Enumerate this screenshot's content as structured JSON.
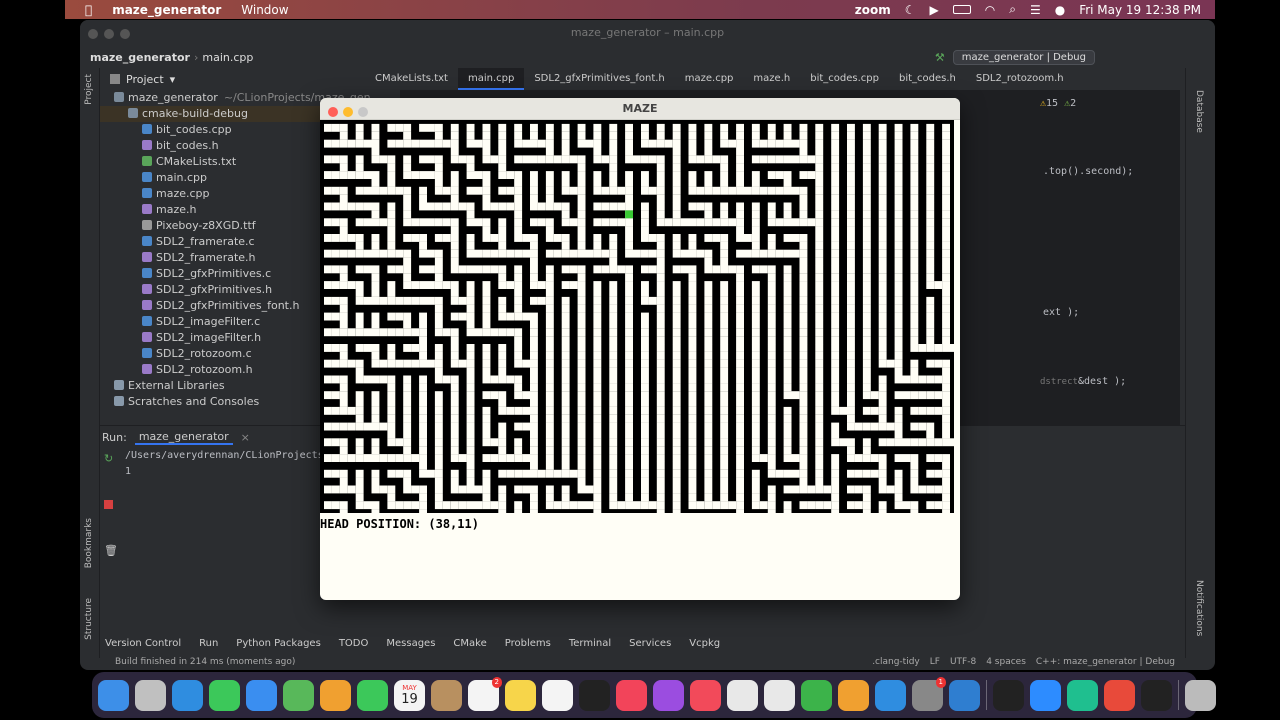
{
  "menubar": {
    "app": "maze_generator",
    "window": "Window",
    "zoom": "zoom",
    "datetime": "Fri May 19  12:38 PM"
  },
  "ide": {
    "title": "maze_generator – main.cpp",
    "breadcrumb": [
      "maze_generator",
      "main.cpp"
    ],
    "run_config": "maze_generator | Debug",
    "project_label": "Project",
    "tree": [
      {
        "label": "maze_generator",
        "suffix": "~/CLionProjects/maze_gen",
        "indent": 0,
        "icon": "folder",
        "selected": false
      },
      {
        "label": "cmake-build-debug",
        "indent": 1,
        "icon": "folder",
        "selected": true
      },
      {
        "label": "bit_codes.cpp",
        "indent": 2,
        "icon": "cpp",
        "selected": false
      },
      {
        "label": "bit_codes.h",
        "indent": 2,
        "icon": "h",
        "selected": false
      },
      {
        "label": "CMakeLists.txt",
        "indent": 2,
        "icon": "cmake",
        "selected": false
      },
      {
        "label": "main.cpp",
        "indent": 2,
        "icon": "cpp",
        "selected": false
      },
      {
        "label": "maze.cpp",
        "indent": 2,
        "icon": "cpp",
        "selected": false
      },
      {
        "label": "maze.h",
        "indent": 2,
        "icon": "h",
        "selected": false
      },
      {
        "label": "Pixeboy-z8XGD.ttf",
        "indent": 2,
        "icon": "file",
        "selected": false
      },
      {
        "label": "SDL2_framerate.c",
        "indent": 2,
        "icon": "c",
        "selected": false
      },
      {
        "label": "SDL2_framerate.h",
        "indent": 2,
        "icon": "h",
        "selected": false
      },
      {
        "label": "SDL2_gfxPrimitives.c",
        "indent": 2,
        "icon": "c",
        "selected": false
      },
      {
        "label": "SDL2_gfxPrimitives.h",
        "indent": 2,
        "icon": "h",
        "selected": false
      },
      {
        "label": "SDL2_gfxPrimitives_font.h",
        "indent": 2,
        "icon": "h",
        "selected": false
      },
      {
        "label": "SDL2_imageFilter.c",
        "indent": 2,
        "icon": "c",
        "selected": false
      },
      {
        "label": "SDL2_imageFilter.h",
        "indent": 2,
        "icon": "h",
        "selected": false
      },
      {
        "label": "SDL2_rotozoom.c",
        "indent": 2,
        "icon": "c",
        "selected": false
      },
      {
        "label": "SDL2_rotozoom.h",
        "indent": 2,
        "icon": "h",
        "selected": false
      },
      {
        "label": "External Libraries",
        "indent": 0,
        "icon": "lib",
        "selected": false
      },
      {
        "label": "Scratches and Consoles",
        "indent": 0,
        "icon": "scratch",
        "selected": false
      }
    ],
    "tabs": [
      {
        "label": "CMakeLists.txt",
        "active": false
      },
      {
        "label": "main.cpp",
        "active": true
      },
      {
        "label": "SDL2_gfxPrimitives_font.h",
        "active": false
      },
      {
        "label": "maze.cpp",
        "active": false
      },
      {
        "label": "maze.h",
        "active": false
      },
      {
        "label": "bit_codes.cpp",
        "active": false
      },
      {
        "label": "bit_codes.h",
        "active": false
      },
      {
        "label": "SDL2_rotozoom.h",
        "active": false
      }
    ],
    "warnings": "15",
    "weak_warnings": "2",
    "code_fragments": {
      "line1": ".top().second);",
      "line2": "ext );",
      "line3": "&dest );",
      "line3_hint": "dstrect:"
    },
    "run": {
      "label": "Run:",
      "config": "maze_generator",
      "path": "/Users/averydrennan/CLionProjects/",
      "output": "1"
    },
    "left_vertical": {
      "project": "Project",
      "bookmarks": "Bookmarks",
      "structure": "Structure"
    },
    "right_vertical": {
      "database": "Database",
      "notifications": "Notifications"
    },
    "bottom_tools": [
      "Version Control",
      "Run",
      "Python Packages",
      "TODO",
      "Messages",
      "CMake",
      "Problems",
      "Terminal",
      "Services",
      "Vcpkg"
    ],
    "status": {
      "message": "Build finished in 214 ms (moments ago)",
      "items": [
        ".clang-tidy",
        "LF",
        "UTF-8",
        "4 spaces",
        "C++: maze_generator | Debug"
      ]
    }
  },
  "maze_window": {
    "title": "MAZE",
    "head_position_text": "HEAD POSITION: (38,11)",
    "rows": [
      "1000101000000000000000000000000000000000",
      "1110111101001100100011000101110000000000",
      "1001001010101111010110011001111000000000",
      "1110011001010000000000000000101000000000",
      "1011100101010001011010011111110000000000",
      "1110001110110110011000010000000000000000",
      "1011011101000101011001111100111000000000",
      "1100010100101010000010001010010000000000",
      "1111101001111011110110110011110000000000",
      "1010101011100001011010101101000000000000",
      "1100011100010101000000000000000000000010",
      "1011111010000100000010000000000000000000",
      "1000100010011000000000000000000000000000",
      "1111110101110000000000000000000000000000",
      "1010010000000000000000000000000000000111",
      "1101111010001000000000000000000000010010",
      "1011000100110000000000000000000000001110",
      "1000000000101000000000000000010000101110",
      "1100000000011000000000000000000010100110",
      "1111000000001000000000000000000001110100",
      "1000100000100000000000000000000010011111",
      "1111110010111000000000000001010001101010",
      "1000101000011111000000000000110001100010",
      "1101010011001000100000000000011101010110",
      "1010110111100011101110011101001101001010"
    ],
    "head_cell": [
      38,
      11
    ],
    "head_color": "#39c934"
  },
  "dock": {
    "calendar_month": "MAY",
    "calendar_day": "19",
    "reminders_badge": "2",
    "settings_badge": "1"
  }
}
